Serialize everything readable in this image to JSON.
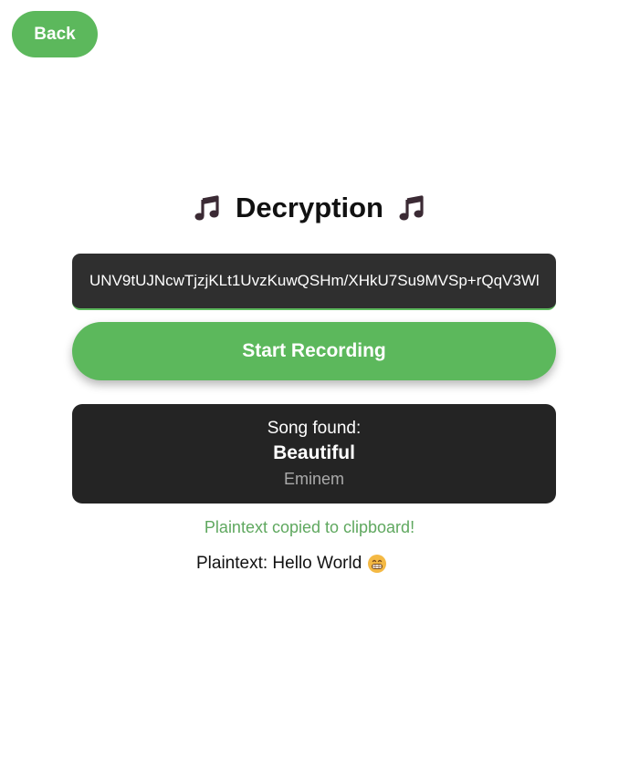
{
  "header": {
    "back_label": "Back"
  },
  "main": {
    "title": "Decryption",
    "ciphertext_value": "UNV9tUJNcwTjzjKLt1UvzKuwQSHm/XHkU7Su9MVSp+rQqV3Wl",
    "record_button_label": "Start Recording",
    "song": {
      "found_label": "Song found:",
      "title": "Beautiful",
      "artist": "Eminem"
    },
    "status_message": "Plaintext copied to clipboard!",
    "plaintext_label": "Plaintext: Hello World"
  },
  "icons": {
    "title_left": "music-note-icon",
    "title_right": "music-note-icon",
    "plaintext_emoji": "grinning-face-icon"
  },
  "colors": {
    "accent": "#5cb85c",
    "input_bg": "#2f2f2f",
    "card_bg": "#242424",
    "status_text": "#5fa85f"
  }
}
